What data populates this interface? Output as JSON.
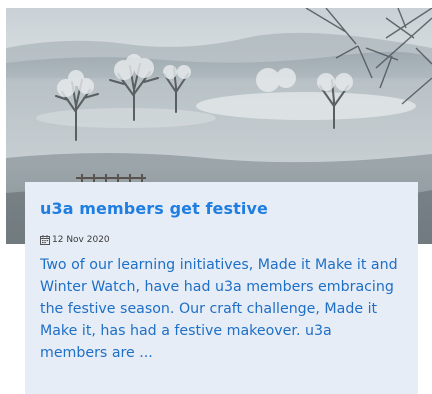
{
  "article": {
    "image_alt": "Frosty winter landscape with bare trees",
    "title": "u3a members get festive",
    "date": "12 Nov 2020",
    "excerpt": "Two of our learning initiatives, Made it Make it and Winter Watch, have had u3a members embracing the festive season. Our craft challenge, Made it Make it, has had a festive makeover. u3a members are ..."
  },
  "icons": {
    "date": "calendar-icon"
  },
  "colors": {
    "title": "#1f7ee0",
    "excerpt": "#1e6fc6",
    "card_background": "#e7edf7",
    "date_text": "#3b3b3b"
  }
}
